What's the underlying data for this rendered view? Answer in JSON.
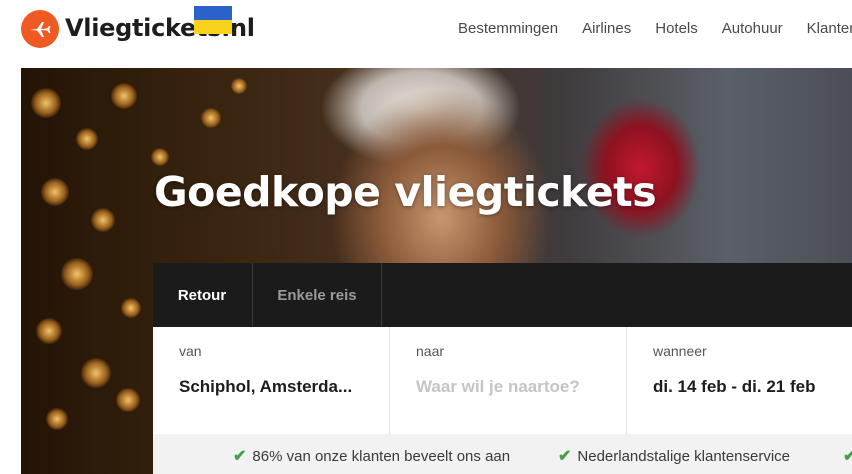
{
  "brand": {
    "name": "Vliegtickets.nl",
    "accent": "#ef5a22",
    "flag_colors": [
      "#2a62c9",
      "#f7d21a"
    ]
  },
  "nav": {
    "items": [
      "Bestemmingen",
      "Airlines",
      "Hotels",
      "Autohuur",
      "Klantens"
    ]
  },
  "hero": {
    "title": "Goedkope vliegtickets"
  },
  "search": {
    "tabs": [
      {
        "label": "Retour",
        "active": true
      },
      {
        "label": "Enkele reis",
        "active": false
      }
    ],
    "from": {
      "label": "van",
      "value": "Schiphol, Amsterda..."
    },
    "to": {
      "label": "naar",
      "placeholder": "Waar wil je naartoe?"
    },
    "when": {
      "label": "wanneer",
      "value": "di. 14 feb - di. 21 feb"
    }
  },
  "usps": [
    "86% van onze klanten beveelt ons aan",
    "Nederlandstalige klantenservice"
  ],
  "icons": {
    "logo": "plane-icon",
    "check": "check-icon"
  }
}
